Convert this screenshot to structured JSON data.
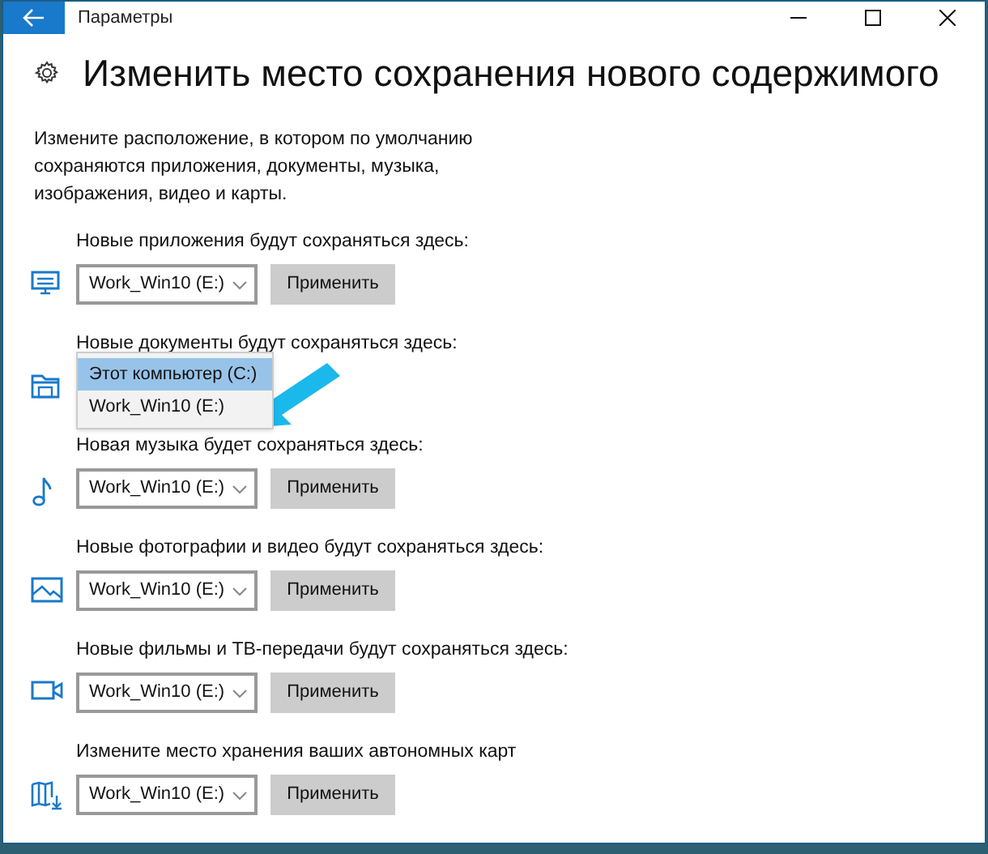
{
  "window": {
    "title": "Параметры"
  },
  "heading": "Изменить место сохранения нового содержимого",
  "description": "Измените расположение, в котором по умолчанию сохраняются приложения, документы, музыка, изображения, видео и карты.",
  "sections": [
    {
      "kind": "select",
      "label": "Новые приложения будут сохраняться здесь:",
      "value": "Work_Win10 (E:)",
      "button": "Применить"
    },
    {
      "kind": "open",
      "label": "Новые документы будут сохраняться здесь:",
      "options": [
        {
          "label": "Этот компьютер (C:)",
          "selected": true
        },
        {
          "label": "Work_Win10 (E:)",
          "selected": false
        }
      ]
    },
    {
      "kind": "select",
      "label": "Новая музыка будет сохраняться здесь:",
      "value": "Work_Win10 (E:)",
      "button": "Применить"
    },
    {
      "kind": "select",
      "label": "Новые фотографии и видео будут сохраняться здесь:",
      "value": "Work_Win10 (E:)",
      "button": "Применить"
    },
    {
      "kind": "select",
      "label": "Новые фильмы и ТВ-передачи будут сохраняться здесь:",
      "value": "Work_Win10 (E:)",
      "button": "Применить"
    },
    {
      "kind": "select",
      "label": "Измените место хранения ваших автономных карт",
      "value": "Work_Win10 (E:)",
      "button": "Применить"
    }
  ]
}
